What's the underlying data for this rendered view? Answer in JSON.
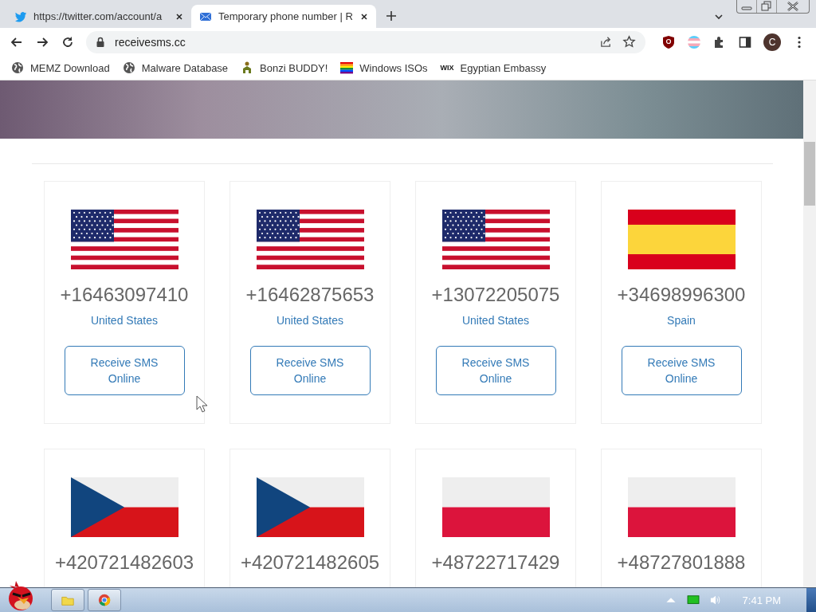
{
  "tabs": [
    {
      "title": "https://twitter.com/account/a",
      "kind": "bird",
      "selected": false
    },
    {
      "title": "Temporary phone number | R",
      "kind": "envelope",
      "selected": true
    }
  ],
  "address_bar": {
    "url": "receivesms.cc"
  },
  "profile": {
    "initial": "C"
  },
  "bookmarks": [
    {
      "label": "MEMZ Download",
      "kind": "globe"
    },
    {
      "label": "Malware Database",
      "kind": "globe"
    },
    {
      "label": "Bonzi BUDDY!",
      "kind": "figure"
    },
    {
      "label": "Windows ISOs",
      "kind": "rainbow"
    },
    {
      "label": "Egyptian Embassy",
      "kind": "wordmark",
      "mark": "WIX"
    }
  ],
  "cards": [
    {
      "kind": "us",
      "number": "+16463097410",
      "country": "United States",
      "button": "Receive SMS Online"
    },
    {
      "kind": "us",
      "number": "+16462875653",
      "country": "United States",
      "button": "Receive SMS Online"
    },
    {
      "kind": "us",
      "number": "+13072205075",
      "country": "United States",
      "button": "Receive SMS Online"
    },
    {
      "kind": "es",
      "number": "+34698996300",
      "country": "Spain",
      "button": "Receive SMS Online"
    },
    {
      "kind": "cz",
      "number": "+420721482603"
    },
    {
      "kind": "cz",
      "number": "+420721482605"
    },
    {
      "kind": "pl",
      "number": "+48722717429"
    },
    {
      "kind": "pl",
      "number": "+48727801888"
    }
  ],
  "taskbar": {
    "clock": "7:41 PM"
  }
}
